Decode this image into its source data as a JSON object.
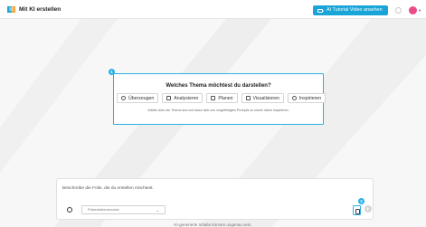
{
  "header": {
    "app_title": "Mit KI erstellen",
    "tutorial_label": "AI Tutorial Video ansehen"
  },
  "colors": {
    "accent": "#2ab0e3",
    "tutorial_button": "#1aa5d8",
    "avatar": "#e84d8a"
  },
  "topic_card": {
    "step": "1",
    "title": "Welches Thema möchtest du darstellen?",
    "options": [
      {
        "label": "Überzeugen",
        "icon": "hand-icon"
      },
      {
        "label": "Analysieren",
        "icon": "document-icon"
      },
      {
        "label": "Planen",
        "icon": "calendar-icon"
      },
      {
        "label": "Visualisieren",
        "icon": "image-icon"
      },
      {
        "label": "Inspirieren",
        "icon": "lightbulb-icon"
      }
    ],
    "hint": "Wähle oben ein Thema aus und lasse dich von vorgefertigten Prompts zu neuen Ideen inspirieren."
  },
  "input": {
    "placeholder": "Beschreibe die Folie, die du erstellen möchtest.",
    "mode_select": "Präsentationsmodus",
    "step": "2"
  },
  "disclaimer": "KI-generierte Inhalte können ungenau sein."
}
